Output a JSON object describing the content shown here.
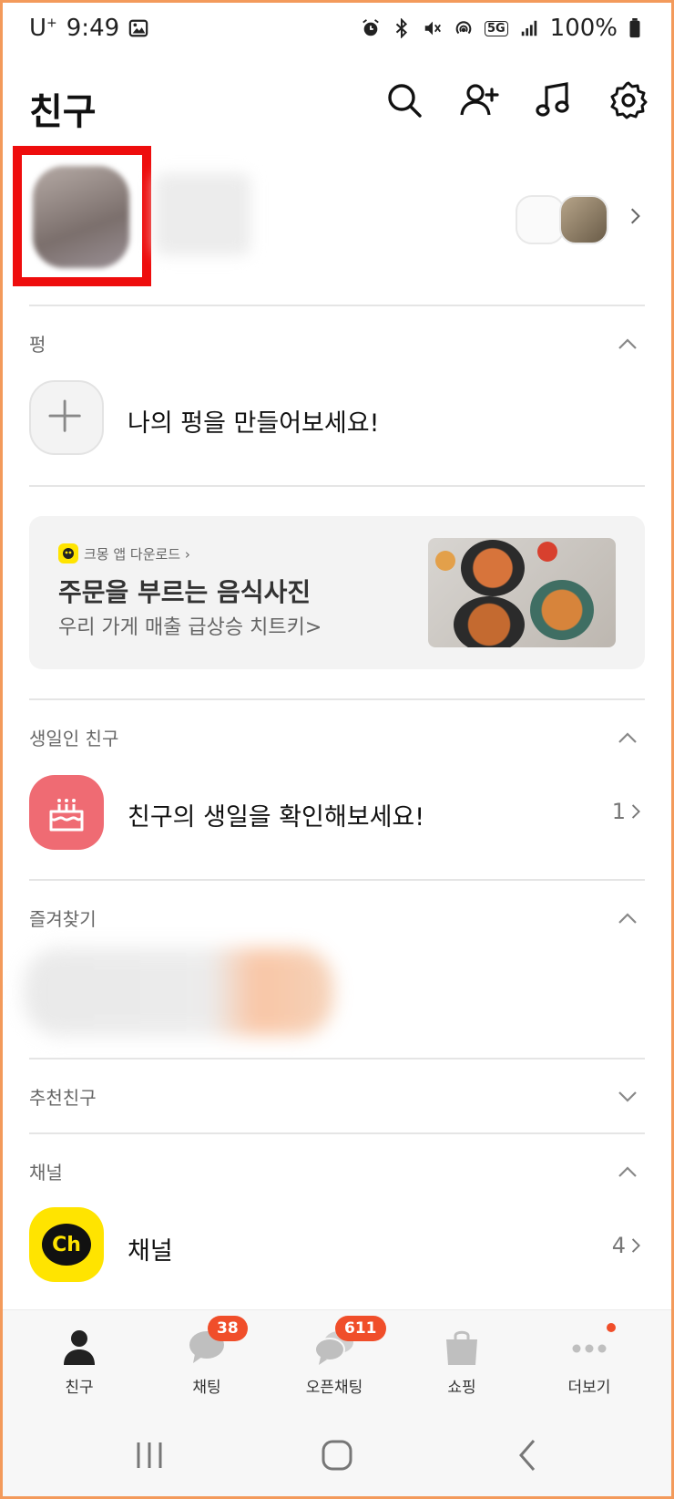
{
  "status_bar": {
    "carrier": "U",
    "carrier_sup": "+",
    "time": "9:49",
    "network": "5G",
    "battery": "100%"
  },
  "header": {
    "title": "친구",
    "icons": [
      "search-icon",
      "add-friend-icon",
      "music-icon",
      "settings-icon"
    ]
  },
  "sections": {
    "pung": {
      "label": "펑",
      "item_text": "나의 펑을 만들어보세요!"
    },
    "birthday": {
      "label": "생일인 친구",
      "item_text": "친구의 생일을 확인해보세요!",
      "count": "1"
    },
    "favorites": {
      "label": "즐겨찾기"
    },
    "recommended": {
      "label": "추천친구"
    },
    "channel": {
      "label": "채널",
      "item_text": "채널",
      "count": "4",
      "logo_text": "Ch"
    }
  },
  "ad": {
    "tag": "크몽 앱 다운로드 ›",
    "title": "주문을 부르는 음식사진",
    "subtitle": "우리 가게 매출 급상승 치트키>"
  },
  "bottom_nav": [
    {
      "label": "친구",
      "badge": ""
    },
    {
      "label": "채팅",
      "badge": "38"
    },
    {
      "label": "오픈채팅",
      "badge": "611"
    },
    {
      "label": "쇼핑",
      "badge": ""
    },
    {
      "label": "더보기",
      "badge": ""
    }
  ],
  "colors": {
    "accent_red": "#f04e2a",
    "kakao_yellow": "#ffe400",
    "birthday_red": "#ef6b73",
    "highlight_box": "#ee0d0d",
    "frame_orange": "#f39a5b"
  }
}
